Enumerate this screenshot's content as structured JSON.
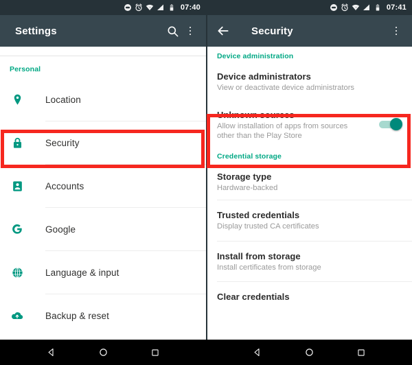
{
  "status_bar": {
    "left_time": "07:40",
    "right_time": "07:41",
    "icons": [
      "do-not-disturb-icon",
      "alarm-icon",
      "wifi-icon",
      "signal-icon",
      "battery-icon"
    ]
  },
  "left_pane": {
    "appbar": {
      "title": "Settings",
      "search_icon": "search-icon",
      "overflow_icon": "more-vert-icon"
    },
    "section_header": "Personal",
    "items": [
      {
        "label": "Location",
        "icon": "location-pin-icon"
      },
      {
        "label": "Security",
        "icon": "lock-icon"
      },
      {
        "label": "Accounts",
        "icon": "account-box-icon"
      },
      {
        "label": "Google",
        "icon": "google-g-icon"
      },
      {
        "label": "Language & input",
        "icon": "globe-icon"
      },
      {
        "label": "Backup & reset",
        "icon": "cloud-upload-icon"
      }
    ],
    "highlighted_item": "Security"
  },
  "right_pane": {
    "appbar": {
      "back_icon": "arrow-back-icon",
      "title": "Security",
      "overflow_icon": "more-vert-icon"
    },
    "sections": [
      {
        "header": "Device administration",
        "rows": [
          {
            "title": "Device administrators",
            "subtitle": "View or deactivate device administrators",
            "toggle": null
          },
          {
            "title": "Unknown sources",
            "subtitle": "Allow installation of apps from sources other than the Play Store",
            "toggle": "on"
          }
        ]
      },
      {
        "header": "Credential storage",
        "rows": [
          {
            "title": "Storage type",
            "subtitle": "Hardware-backed",
            "toggle": null
          },
          {
            "title": "Trusted credentials",
            "subtitle": "Display trusted CA certificates",
            "toggle": null
          },
          {
            "title": "Install from storage",
            "subtitle": "Install certificates from storage",
            "toggle": null
          },
          {
            "title": "Clear credentials",
            "subtitle": "",
            "toggle": null
          }
        ]
      }
    ],
    "highlighted_row": "Unknown sources"
  },
  "nav_bar": {
    "buttons": [
      "back-triangle-icon",
      "home-circle-icon",
      "recents-square-icon"
    ]
  },
  "colors": {
    "accent_teal": "#00a884",
    "icon_teal": "#009881",
    "appbar": "#37474F",
    "status_bar": "#263238",
    "highlight_red": "#f6271f"
  }
}
